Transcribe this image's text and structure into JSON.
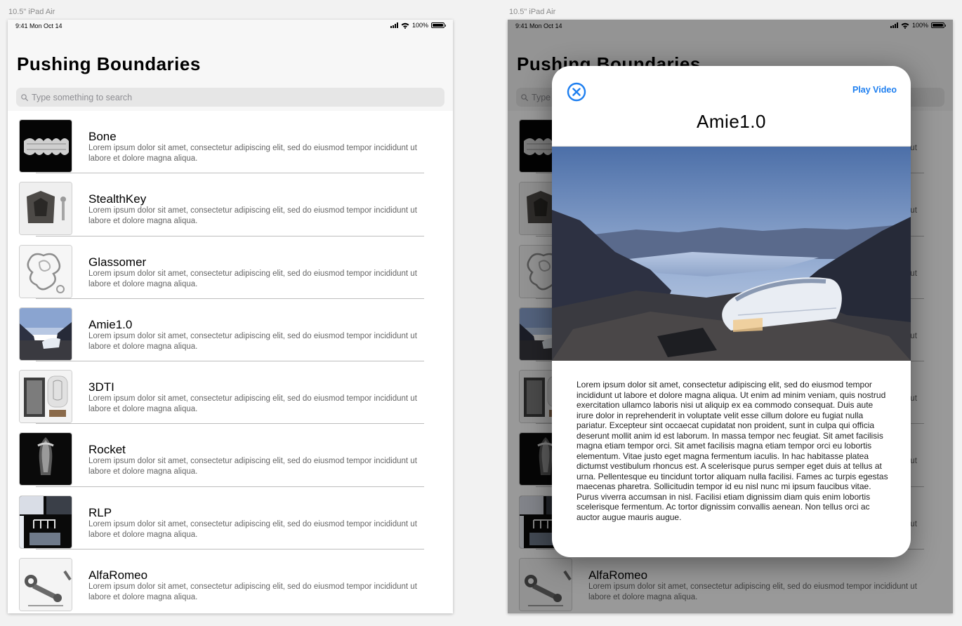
{
  "device_label": "10.5\" iPad Air",
  "status": {
    "time": "9:41  Mon Oct 14",
    "battery": "100%",
    "battery_level": 1.0
  },
  "title": "Pushing Boundaries",
  "search": {
    "placeholder": "Type something to search"
  },
  "items": [
    {
      "name": "Bone",
      "desc": "Lorem ipsum dolor sit amet, consectetur adipiscing elit, sed do eiusmod tempor incididunt ut labore et dolore magna aliqua."
    },
    {
      "name": "StealthKey",
      "desc": "Lorem ipsum dolor sit amet, consectetur adipiscing elit, sed do eiusmod tempor incididunt ut labore et dolore magna aliqua."
    },
    {
      "name": "Glassomer",
      "desc": "Lorem ipsum dolor sit amet, consectetur adipiscing elit, sed do eiusmod tempor incididunt ut labore et dolore magna aliqua."
    },
    {
      "name": "Amie1.0",
      "desc": "Lorem ipsum dolor sit amet, consectetur adipiscing elit, sed do eiusmod tempor incididunt ut labore et dolore magna aliqua."
    },
    {
      "name": "3DTI",
      "desc": "Lorem ipsum dolor sit amet, consectetur adipiscing elit, sed do eiusmod tempor incididunt ut labore et dolore magna aliqua."
    },
    {
      "name": "Rocket",
      "desc": "Lorem ipsum dolor sit amet, consectetur adipiscing elit, sed do eiusmod tempor incididunt ut labore et dolore magna aliqua."
    },
    {
      "name": "RLP",
      "desc": "Lorem ipsum dolor sit amet, consectetur adipiscing elit, sed do eiusmod tempor incididunt ut labore et dolore magna aliqua."
    },
    {
      "name": "AlfaRomeo",
      "desc": "Lorem ipsum dolor sit amet, consectetur adipiscing elit, sed do eiusmod tempor incididunt ut labore et dolore magna aliqua."
    }
  ],
  "modal": {
    "play_label": "Play Video",
    "title": "Amie1.0",
    "body": "Lorem ipsum dolor sit amet, consectetur adipiscing elit, sed do eiusmod tempor incididunt ut labore et dolore magna aliqua. Ut enim ad minim veniam, quis nostrud exercitation ullamco laboris nisi ut aliquip ex ea commodo consequat. Duis aute irure dolor in reprehenderit in voluptate velit esse cillum dolore eu fugiat nulla pariatur. Excepteur sint occaecat cupidatat non proident, sunt in culpa qui officia deserunt mollit anim id est laborum. In massa tempor nec feugiat. Sit amet facilisis magna etiam tempor orci. Sit amet facilisis magna etiam tempor orci eu lobortis elementum. Vitae justo eget magna fermentum iaculis. In hac habitasse platea dictumst vestibulum rhoncus est. A scelerisque purus semper eget duis at tellus at urna. Pellentesque eu tincidunt tortor aliquam nulla facilisi. Fames ac turpis egestas maecenas pharetra. Sollicitudin tempor id eu nisl nunc mi ipsum faucibus vitae. Purus viverra accumsan in nisl. Facilisi etiam dignissim diam quis enim lobortis scelerisque fermentum. Ac tortor dignissim convallis aenean. Non tellus orci ac auctor augue mauris augue."
  },
  "colors": {
    "accent": "#1e7ff0",
    "overlay": "#000000"
  },
  "icons": [
    "search-icon",
    "close-icon",
    "signal-icon",
    "wifi-icon",
    "battery-icon"
  ]
}
